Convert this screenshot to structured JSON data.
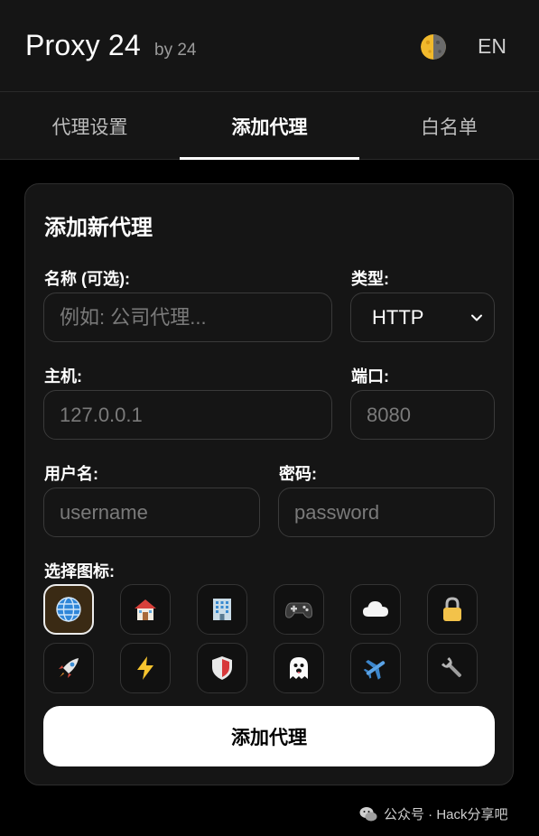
{
  "header": {
    "title": "Proxy 24",
    "subtitle": "by 24",
    "theme_icon": "half-moon-icon",
    "lang_label": "EN"
  },
  "tabs": [
    {
      "label": "代理设置",
      "active": false
    },
    {
      "label": "添加代理",
      "active": true
    },
    {
      "label": "白名单",
      "active": false
    }
  ],
  "form": {
    "title": "添加新代理",
    "name": {
      "label": "名称 (可选):",
      "placeholder": "例如: 公司代理..."
    },
    "type": {
      "label": "类型:",
      "value": "HTTP"
    },
    "host": {
      "label": "主机:",
      "placeholder": "127.0.0.1"
    },
    "port": {
      "label": "端口:",
      "placeholder": "8080"
    },
    "username": {
      "label": "用户名:",
      "placeholder": "username"
    },
    "password": {
      "label": "密码:",
      "placeholder": "password"
    },
    "icon_label": "选择图标:",
    "icons": [
      {
        "name": "globe-icon",
        "selected": true
      },
      {
        "name": "house-icon",
        "selected": false
      },
      {
        "name": "office-building-icon",
        "selected": false
      },
      {
        "name": "game-controller-icon",
        "selected": false
      },
      {
        "name": "cloud-icon",
        "selected": false
      },
      {
        "name": "lock-icon",
        "selected": false
      },
      {
        "name": "rocket-icon",
        "selected": false
      },
      {
        "name": "lightning-icon",
        "selected": false
      },
      {
        "name": "shield-icon",
        "selected": false
      },
      {
        "name": "ghost-icon",
        "selected": false
      },
      {
        "name": "airplane-icon",
        "selected": false
      },
      {
        "name": "wrench-icon",
        "selected": false
      }
    ],
    "submit_label": "添加代理"
  },
  "footer": {
    "watermark": "公众号 · Hack分享吧",
    "watermark_icon": "wechat-icon"
  },
  "colors": {
    "background": "#000000",
    "panel": "#151515",
    "border": "#333333",
    "accent": "#ffffff",
    "selected_icon_bg": "#3a2a14"
  }
}
